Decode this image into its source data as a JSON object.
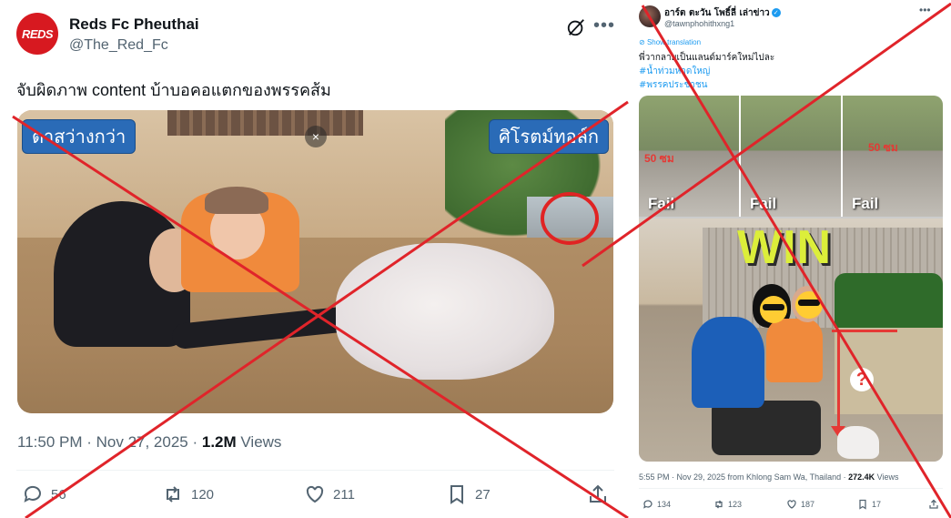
{
  "left_tweet": {
    "avatar_text": "REDS",
    "display_name": "Reds Fc Pheuthai",
    "handle": "@The_Red_Fc",
    "text": "จับผิดภาพ content บ้าบอคอแตกของพรรคส้ม",
    "media": {
      "label_left": "ตาสว่างกว่า",
      "label_right": "ศิโรตม์ทอล์ก",
      "close_glyph": "×"
    },
    "time": "11:50 PM · Nov 27, 2025 · ",
    "views_count": "1.2M",
    "views_label": " Views",
    "actions": {
      "reply": "56",
      "repost": "120",
      "like": "211",
      "bookmark": "27"
    }
  },
  "right_tweet": {
    "display_name": "อาร์ต ตะวัน โพธิ์ลี่ เล่าข่าว",
    "handle": "@tawnphohithxng1",
    "show_translation": "Show translation",
    "text_line1": "พี่วากลายเป็นแลนด์มาร์คใหม่ไปละ",
    "hashtag1": "#น้ำท่วมหาดใหญ่",
    "hashtag2": "#พรรคประชาชน",
    "media": {
      "fail1": "Fail",
      "fail2": "Fail",
      "fail3": "Fail",
      "measure1": "50 ซม",
      "measure2": "50 ซม",
      "win": "WIN",
      "question": "?"
    },
    "meta_time": "5:55 PM · Nov 29, 2025 from Khlong Sam Wa, Thailand · ",
    "meta_views_count": "272.4K",
    "meta_views_label": " Views",
    "actions": {
      "reply": "134",
      "repost": "123",
      "like": "187",
      "bookmark": "17"
    }
  },
  "colors": {
    "cross": "#e0242a",
    "link": "#1d9bf0",
    "muted": "#536471",
    "badge_blue": "#2a6bb7"
  },
  "icons": [
    "grok-icon",
    "more-icon",
    "reply-icon",
    "repost-icon",
    "like-icon",
    "bookmark-icon",
    "share-icon",
    "verified-icon",
    "translate-icon"
  ]
}
